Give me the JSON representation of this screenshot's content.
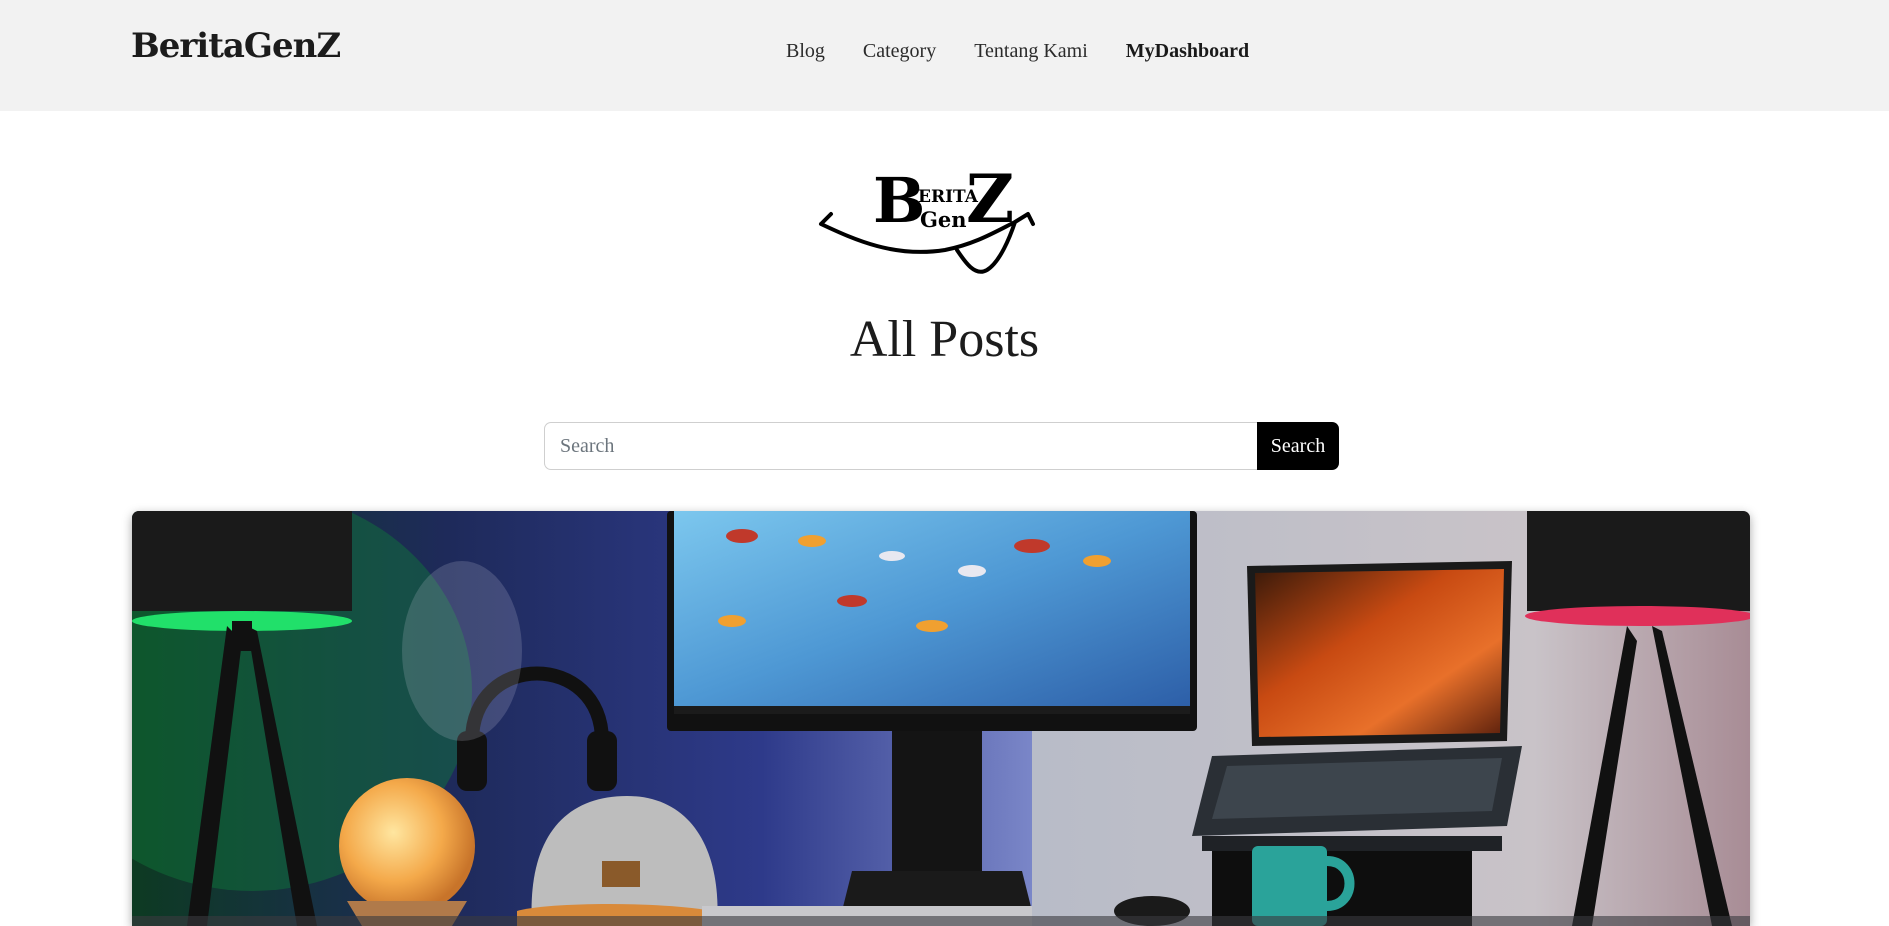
{
  "navbar": {
    "brand": "BeritaGenZ",
    "links": [
      {
        "label": "Blog"
      },
      {
        "label": "Category"
      },
      {
        "label": "Tentang Kami"
      },
      {
        "label": "MyDashboard"
      }
    ]
  },
  "logo": {
    "big_left": "B",
    "small_top": "ERITA",
    "small_bottom": "Gen",
    "big_right": "Z"
  },
  "main": {
    "title": "All Posts",
    "search": {
      "placeholder": "Search",
      "value": "",
      "button_label": "Search"
    }
  },
  "colors": {
    "navbar_bg": "#f2f2f2",
    "button_bg": "#000000",
    "button_text": "#ffffff"
  },
  "featured_post": {
    "image": "desk-setup-photo"
  }
}
